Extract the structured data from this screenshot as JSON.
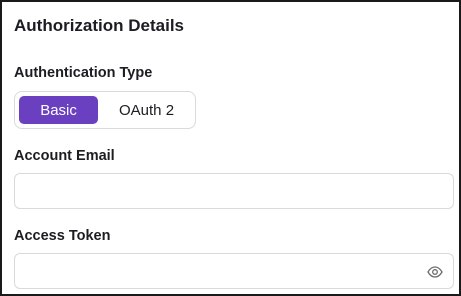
{
  "section": {
    "title": "Authorization Details"
  },
  "auth_type": {
    "label": "Authentication Type",
    "options": [
      {
        "label": "Basic",
        "selected": true
      },
      {
        "label": "OAuth 2",
        "selected": false
      }
    ],
    "accent_color": "#6a3fc0"
  },
  "account_email": {
    "label": "Account Email",
    "value": "",
    "placeholder": ""
  },
  "access_token": {
    "label": "Access Token",
    "value": "",
    "placeholder": "",
    "icon": "eye-icon"
  }
}
